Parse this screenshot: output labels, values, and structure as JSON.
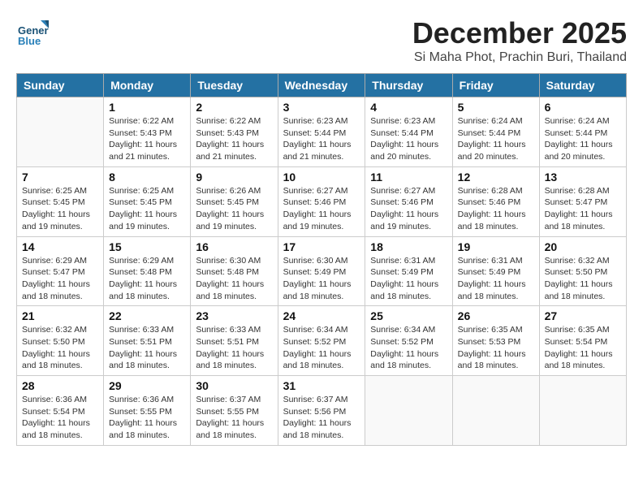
{
  "logo": {
    "general": "General",
    "blue": "Blue"
  },
  "header": {
    "month": "December 2025",
    "location": "Si Maha Phot, Prachin Buri, Thailand"
  },
  "weekdays": [
    "Sunday",
    "Monday",
    "Tuesday",
    "Wednesday",
    "Thursday",
    "Friday",
    "Saturday"
  ],
  "weeks": [
    [
      {
        "day": "",
        "info": ""
      },
      {
        "day": "1",
        "info": "Sunrise: 6:22 AM\nSunset: 5:43 PM\nDaylight: 11 hours\nand 21 minutes."
      },
      {
        "day": "2",
        "info": "Sunrise: 6:22 AM\nSunset: 5:43 PM\nDaylight: 11 hours\nand 21 minutes."
      },
      {
        "day": "3",
        "info": "Sunrise: 6:23 AM\nSunset: 5:44 PM\nDaylight: 11 hours\nand 21 minutes."
      },
      {
        "day": "4",
        "info": "Sunrise: 6:23 AM\nSunset: 5:44 PM\nDaylight: 11 hours\nand 20 minutes."
      },
      {
        "day": "5",
        "info": "Sunrise: 6:24 AM\nSunset: 5:44 PM\nDaylight: 11 hours\nand 20 minutes."
      },
      {
        "day": "6",
        "info": "Sunrise: 6:24 AM\nSunset: 5:44 PM\nDaylight: 11 hours\nand 20 minutes."
      }
    ],
    [
      {
        "day": "7",
        "info": "Sunrise: 6:25 AM\nSunset: 5:45 PM\nDaylight: 11 hours\nand 19 minutes."
      },
      {
        "day": "8",
        "info": "Sunrise: 6:25 AM\nSunset: 5:45 PM\nDaylight: 11 hours\nand 19 minutes."
      },
      {
        "day": "9",
        "info": "Sunrise: 6:26 AM\nSunset: 5:45 PM\nDaylight: 11 hours\nand 19 minutes."
      },
      {
        "day": "10",
        "info": "Sunrise: 6:27 AM\nSunset: 5:46 PM\nDaylight: 11 hours\nand 19 minutes."
      },
      {
        "day": "11",
        "info": "Sunrise: 6:27 AM\nSunset: 5:46 PM\nDaylight: 11 hours\nand 19 minutes."
      },
      {
        "day": "12",
        "info": "Sunrise: 6:28 AM\nSunset: 5:46 PM\nDaylight: 11 hours\nand 18 minutes."
      },
      {
        "day": "13",
        "info": "Sunrise: 6:28 AM\nSunset: 5:47 PM\nDaylight: 11 hours\nand 18 minutes."
      }
    ],
    [
      {
        "day": "14",
        "info": "Sunrise: 6:29 AM\nSunset: 5:47 PM\nDaylight: 11 hours\nand 18 minutes."
      },
      {
        "day": "15",
        "info": "Sunrise: 6:29 AM\nSunset: 5:48 PM\nDaylight: 11 hours\nand 18 minutes."
      },
      {
        "day": "16",
        "info": "Sunrise: 6:30 AM\nSunset: 5:48 PM\nDaylight: 11 hours\nand 18 minutes."
      },
      {
        "day": "17",
        "info": "Sunrise: 6:30 AM\nSunset: 5:49 PM\nDaylight: 11 hours\nand 18 minutes."
      },
      {
        "day": "18",
        "info": "Sunrise: 6:31 AM\nSunset: 5:49 PM\nDaylight: 11 hours\nand 18 minutes."
      },
      {
        "day": "19",
        "info": "Sunrise: 6:31 AM\nSunset: 5:49 PM\nDaylight: 11 hours\nand 18 minutes."
      },
      {
        "day": "20",
        "info": "Sunrise: 6:32 AM\nSunset: 5:50 PM\nDaylight: 11 hours\nand 18 minutes."
      }
    ],
    [
      {
        "day": "21",
        "info": "Sunrise: 6:32 AM\nSunset: 5:50 PM\nDaylight: 11 hours\nand 18 minutes."
      },
      {
        "day": "22",
        "info": "Sunrise: 6:33 AM\nSunset: 5:51 PM\nDaylight: 11 hours\nand 18 minutes."
      },
      {
        "day": "23",
        "info": "Sunrise: 6:33 AM\nSunset: 5:51 PM\nDaylight: 11 hours\nand 18 minutes."
      },
      {
        "day": "24",
        "info": "Sunrise: 6:34 AM\nSunset: 5:52 PM\nDaylight: 11 hours\nand 18 minutes."
      },
      {
        "day": "25",
        "info": "Sunrise: 6:34 AM\nSunset: 5:52 PM\nDaylight: 11 hours\nand 18 minutes."
      },
      {
        "day": "26",
        "info": "Sunrise: 6:35 AM\nSunset: 5:53 PM\nDaylight: 11 hours\nand 18 minutes."
      },
      {
        "day": "27",
        "info": "Sunrise: 6:35 AM\nSunset: 5:54 PM\nDaylight: 11 hours\nand 18 minutes."
      }
    ],
    [
      {
        "day": "28",
        "info": "Sunrise: 6:36 AM\nSunset: 5:54 PM\nDaylight: 11 hours\nand 18 minutes."
      },
      {
        "day": "29",
        "info": "Sunrise: 6:36 AM\nSunset: 5:55 PM\nDaylight: 11 hours\nand 18 minutes."
      },
      {
        "day": "30",
        "info": "Sunrise: 6:37 AM\nSunset: 5:55 PM\nDaylight: 11 hours\nand 18 minutes."
      },
      {
        "day": "31",
        "info": "Sunrise: 6:37 AM\nSunset: 5:56 PM\nDaylight: 11 hours\nand 18 minutes."
      },
      {
        "day": "",
        "info": ""
      },
      {
        "day": "",
        "info": ""
      },
      {
        "day": "",
        "info": ""
      }
    ]
  ]
}
